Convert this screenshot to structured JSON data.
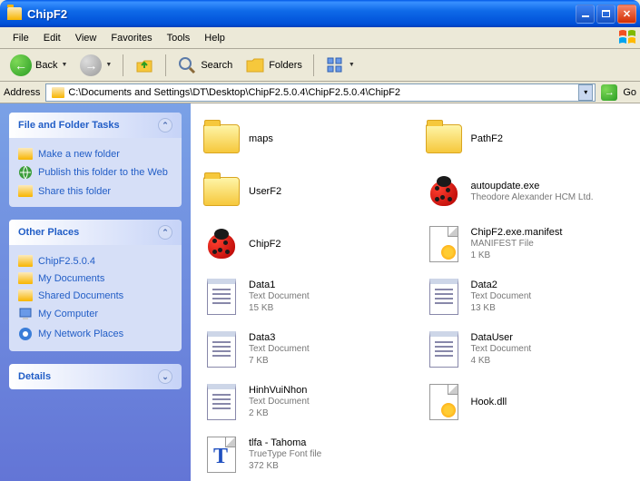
{
  "window": {
    "title": "ChipF2"
  },
  "menu": {
    "file": "File",
    "edit": "Edit",
    "view": "View",
    "favorites": "Favorites",
    "tools": "Tools",
    "help": "Help"
  },
  "toolbar": {
    "back": "Back",
    "search": "Search",
    "folders": "Folders"
  },
  "address": {
    "label": "Address",
    "path": "C:\\Documents and Settings\\DT\\Desktop\\ChipF2.5.0.4\\ChipF2.5.0.4\\ChipF2",
    "go": "Go"
  },
  "sidebar": {
    "tasks": {
      "title": "File and Folder Tasks",
      "items": {
        "new_folder": "Make a new folder",
        "publish": "Publish this folder to the Web",
        "share": "Share this folder"
      }
    },
    "places": {
      "title": "Other Places",
      "items": {
        "parent": "ChipF2.5.0.4",
        "mydocs": "My Documents",
        "shared": "Shared Documents",
        "mycomp": "My Computer",
        "network": "My Network Places"
      }
    },
    "details": {
      "title": "Details"
    }
  },
  "files": {
    "maps": {
      "name": "maps"
    },
    "pathf2": {
      "name": "PathF2"
    },
    "userf2": {
      "name": "UserF2"
    },
    "autoupdate": {
      "name": "autoupdate.exe",
      "meta": "Theodore Alexander HCM Ltd."
    },
    "chipf2": {
      "name": "ChipF2"
    },
    "manifest": {
      "name": "ChipF2.exe.manifest",
      "type": "MANIFEST File",
      "size": "1 KB"
    },
    "data1": {
      "name": "Data1",
      "type": "Text Document",
      "size": "15 KB"
    },
    "data2": {
      "name": "Data2",
      "type": "Text Document",
      "size": "13 KB"
    },
    "data3": {
      "name": "Data3",
      "type": "Text Document",
      "size": "7 KB"
    },
    "datauser": {
      "name": "DataUser",
      "type": "Text Document",
      "size": "4 KB"
    },
    "hinh": {
      "name": "HinhVuiNhon",
      "type": "Text Document",
      "size": "2 KB"
    },
    "hook": {
      "name": "Hook.dll"
    },
    "tlfa": {
      "name": "tlfa - Tahoma",
      "type": "TrueType Font file",
      "size": "372 KB"
    }
  }
}
